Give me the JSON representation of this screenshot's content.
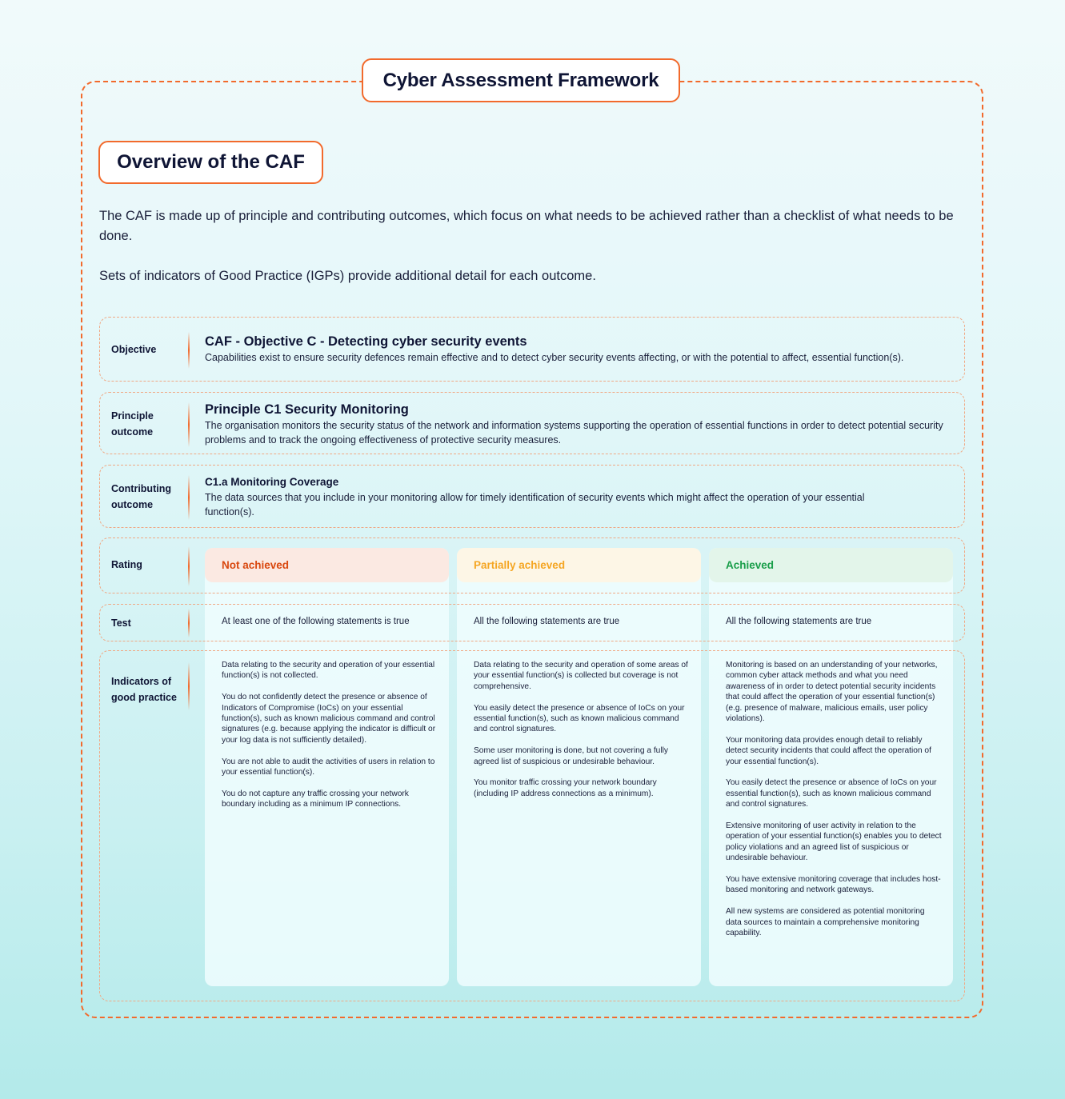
{
  "header": {
    "title": "Cyber Assessment Framework",
    "section_title": "Overview of the CAF"
  },
  "intro": {
    "paragraphs": [
      "The CAF is made up of principle and contributing outcomes, which focus on what needs to be achieved rather than a checklist of what needs to be done.",
      "Sets of indicators of Good Practice (IGPs) provide additional detail for each outcome."
    ]
  },
  "rows": {
    "objective": {
      "label": "Objective",
      "title": "CAF - Objective C - Detecting cyber security events",
      "description": "Capabilities exist to ensure security defences remain effective and to detect cyber security events affecting, or with the potential to affect, essential function(s)."
    },
    "principle": {
      "label_line1": "Principle",
      "label_line2": "outcome",
      "title": "Principle C1 Security Monitoring",
      "description": "The organisation monitors the security status of the network and information systems supporting the operation of essential functions in order to detect potential security problems and to track the ongoing effectiveness of protective security measures."
    },
    "contributing": {
      "label_line1": "Contributing",
      "label_line2": "outcome",
      "title": "C1.a Monitoring Coverage",
      "description": "The data sources that you include in your monitoring allow for timely identification of security events which might affect the operation of your essential function(s)."
    },
    "rating": {
      "label": "Rating"
    },
    "test": {
      "label": "Test"
    },
    "indicators": {
      "label_line1": "Indicators of",
      "label_line2": "good practice"
    }
  },
  "ratings": [
    {
      "name": "Not achieved",
      "color": "#d9480f",
      "bg": "#fbe9e2",
      "test": "At least one of the following statements is true",
      "indicators": [
        "Data relating to the security and operation of your essential function(s) is not collected.",
        "You do not confidently detect the presence or absence of Indicators of Compromise (IoCs) on your essential function(s), such as known malicious command and control signatures (e.g. because applying the indicator is difficult or your log data is not sufficiently detailed).",
        "You are not able to audit the activities of users in relation to your essential function(s).",
        "You do not capture any traffic crossing your network boundary including as a minimum IP connections."
      ]
    },
    {
      "name": "Partially achieved",
      "color": "#f5a623",
      "bg": "#fdf6e6",
      "test": "All the following statements  are true",
      "indicators": [
        "Data relating to the security and operation of some areas of your essential function(s) is collected but coverage is not comprehensive.",
        "You easily detect the presence or absence of IoCs on your essential function(s), such as known malicious command and control signatures.",
        "Some user monitoring is done, but not covering a fully agreed list of suspicious or undesirable behaviour.",
        "You monitor traffic crossing your network boundary (including IP address connections as a minimum)."
      ]
    },
    {
      "name": "Achieved",
      "color": "#1a9e4a",
      "bg": "#e3f5ea",
      "test": "All the following statements are true",
      "indicators": [
        "Monitoring is based on an understanding of your networks, common cyber attack methods and what you need awareness of in order to detect potential security incidents that could affect the operation of your essential function(s) (e.g. presence of malware, malicious emails, user policy violations).",
        "Your monitoring data provides enough detail to reliably detect security incidents that could affect the operation of your essential function(s).",
        "You easily detect the presence or absence of IoCs on your essential function(s), such as known malicious command and control signatures.",
        "Extensive monitoring of user activity in relation to the operation of your essential function(s) enables you to detect policy violations and an agreed list of suspicious or undesirable behaviour.",
        "You have extensive monitoring coverage that includes host-based monitoring and network gateways.",
        "All new systems are considered as potential monitoring data sources to maintain a comprehensive monitoring capability."
      ]
    }
  ]
}
